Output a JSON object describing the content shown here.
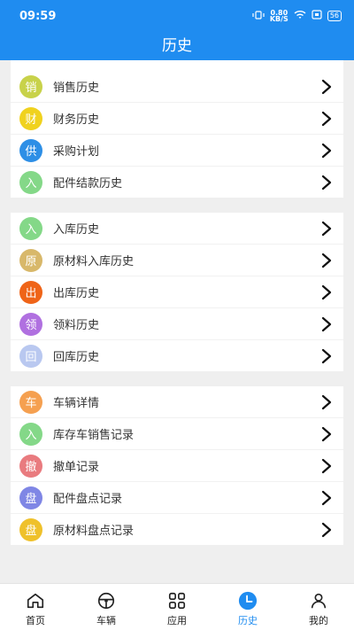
{
  "status": {
    "time": "09:59",
    "speed_top": "0.80",
    "speed_bottom": "KB/S",
    "battery": "56"
  },
  "header": {
    "title": "历史"
  },
  "groups": [
    [
      {
        "badge": "销",
        "label": "销售历史",
        "color": "#c8d24a"
      },
      {
        "badge": "财",
        "label": "财务历史",
        "color": "#f0d21e"
      },
      {
        "badge": "供",
        "label": "采购计划",
        "color": "#2e8fe6"
      },
      {
        "badge": "入",
        "label": "配件结款历史",
        "color": "#84d888"
      }
    ],
    [
      {
        "badge": "入",
        "label": "入库历史",
        "color": "#84d888"
      },
      {
        "badge": "原",
        "label": "原材料入库历史",
        "color": "#d8b86a"
      },
      {
        "badge": "出",
        "label": "出库历史",
        "color": "#ef6418"
      },
      {
        "badge": "领",
        "label": "领料历史",
        "color": "#b070e0"
      },
      {
        "badge": "回",
        "label": "回库历史",
        "color": "#b9c8f0"
      }
    ],
    [
      {
        "badge": "车",
        "label": "车辆详情",
        "color": "#f5a050"
      },
      {
        "badge": "入",
        "label": "库存车销售记录",
        "color": "#84d888"
      },
      {
        "badge": "撤",
        "label": "撤单记录",
        "color": "#e97b7f"
      },
      {
        "badge": "盘",
        "label": "配件盘点记录",
        "color": "#7f86e5"
      },
      {
        "badge": "盘",
        "label": "原材料盘点记录",
        "color": "#efc12b"
      }
    ]
  ],
  "tabs": [
    {
      "label": "首页",
      "icon": "home-icon"
    },
    {
      "label": "车辆",
      "icon": "steering-wheel-icon"
    },
    {
      "label": "应用",
      "icon": "apps-grid-icon"
    },
    {
      "label": "历史",
      "icon": "clock-icon",
      "active": true
    },
    {
      "label": "我的",
      "icon": "user-icon"
    }
  ],
  "colors": {
    "accent": "#1f8cf0"
  }
}
